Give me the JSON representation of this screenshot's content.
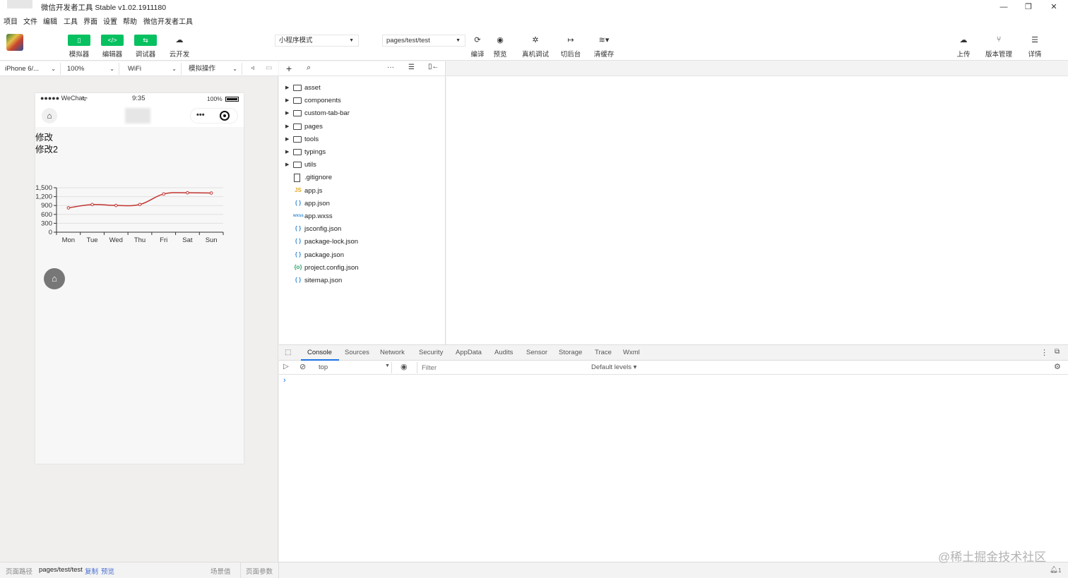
{
  "window": {
    "title": "微信开发者工具 Stable v1.02.1911180",
    "controls": [
      "—",
      "❐",
      "✕"
    ]
  },
  "menu": [
    "项目",
    "文件",
    "编辑",
    "工具",
    "界面",
    "设置",
    "帮助",
    "微信开发者工具"
  ],
  "toolbar": {
    "left_buttons": [
      {
        "label": "模拟器",
        "glyph": "▯"
      },
      {
        "label": "编辑器",
        "glyph": "</>"
      },
      {
        "label": "调试器",
        "glyph": "⇆"
      },
      {
        "label": "云开发",
        "glyph": "☁"
      }
    ],
    "mode_select": "小程序模式",
    "page_select": "pages/test/test",
    "actions": [
      {
        "label": "编译",
        "icon": "refresh-icon"
      },
      {
        "label": "预览",
        "icon": "eye-icon"
      },
      {
        "label": "真机调试",
        "icon": "bug-icon"
      },
      {
        "label": "切后台",
        "icon": "switch-icon"
      },
      {
        "label": "清缓存",
        "icon": "layers-icon"
      }
    ],
    "right_actions": [
      {
        "label": "上传",
        "icon": "upload-icon"
      },
      {
        "label": "版本管理",
        "icon": "branch-icon"
      },
      {
        "label": "详情",
        "icon": "menu-icon"
      }
    ]
  },
  "simulator_bar": {
    "device": "iPhone 6/...",
    "zoom": "100%",
    "network": "WiFi",
    "operation": "模拟操作"
  },
  "phone": {
    "carrier": "●●●●● WeChat",
    "time": "9:35",
    "battery": "100%",
    "lines": [
      "修改",
      "修改2"
    ],
    "menu_dots": "•••"
  },
  "chart_data": {
    "type": "line",
    "categories": [
      "Mon",
      "Tue",
      "Wed",
      "Thu",
      "Fri",
      "Sat",
      "Sun"
    ],
    "series": [
      {
        "values": [
          820,
          932,
          901,
          934,
          1290,
          1330,
          1320
        ],
        "color": "#c23531"
      }
    ],
    "yticks": [
      "1,500",
      "1,200",
      "900",
      "600",
      "300",
      "0"
    ],
    "ylim": [
      0,
      1500
    ],
    "grid": true
  },
  "file_tree": [
    {
      "name": "asset",
      "type": "folder"
    },
    {
      "name": "components",
      "type": "folder"
    },
    {
      "name": "custom-tab-bar",
      "type": "folder"
    },
    {
      "name": "pages",
      "type": "folder"
    },
    {
      "name": "tools",
      "type": "folder"
    },
    {
      "name": "typings",
      "type": "folder"
    },
    {
      "name": "utils",
      "type": "folder"
    },
    {
      "name": ".gitignore",
      "type": "file",
      "icon": "file"
    },
    {
      "name": "app.js",
      "type": "file",
      "icon": "js"
    },
    {
      "name": "app.json",
      "type": "file",
      "icon": "json"
    },
    {
      "name": "app.wxss",
      "type": "file",
      "icon": "wxss"
    },
    {
      "name": "jsconfig.json",
      "type": "file",
      "icon": "json"
    },
    {
      "name": "package-lock.json",
      "type": "file",
      "icon": "json"
    },
    {
      "name": "package.json",
      "type": "file",
      "icon": "json"
    },
    {
      "name": "project.config.json",
      "type": "file",
      "icon": "config"
    },
    {
      "name": "sitemap.json",
      "type": "file",
      "icon": "json"
    }
  ],
  "file_icons": {
    "js": "JS",
    "json": "{ }",
    "wxss": "wxss",
    "config": "{o}"
  },
  "devtools": {
    "tabs": [
      "Console",
      "Sources",
      "Network",
      "Security",
      "AppData",
      "Audits",
      "Sensor",
      "Storage",
      "Trace",
      "Wxml"
    ],
    "active_tab": "Console",
    "context": "top",
    "filter_placeholder": "Filter",
    "levels": "Default levels ▾",
    "prompt": "›"
  },
  "statusbar": {
    "path_label": "页面路径",
    "path": "pages/test/test",
    "copy": "复制",
    "preview": "预览",
    "scene": "场景值",
    "params": "页面参数",
    "notifications": "1"
  },
  "watermark": "@稀土掘金技术社区",
  "colors": {
    "green": "#07c160",
    "accent": "#1a73e8",
    "line": "#c23531"
  }
}
